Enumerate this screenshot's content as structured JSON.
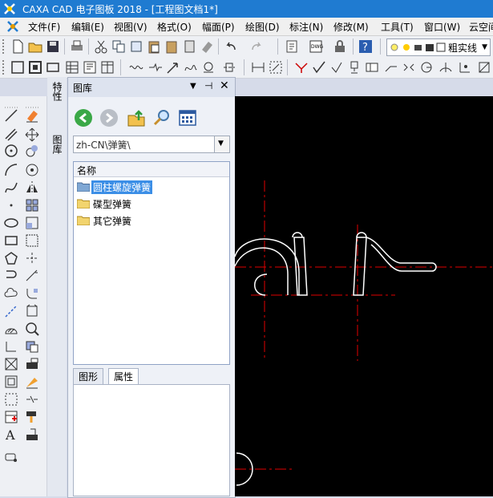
{
  "window": {
    "title": "CAXA CAD 电子图板 2018 - [工程图文档1*]"
  },
  "menu": {
    "items": [
      {
        "label": "文件(F)"
      },
      {
        "label": "编辑(E)"
      },
      {
        "label": "视图(V)"
      },
      {
        "label": "格式(O)"
      },
      {
        "label": "幅面(P)"
      },
      {
        "label": "绘图(D)"
      },
      {
        "label": "标注(N)"
      },
      {
        "label": "修改(M)"
      },
      {
        "label": "工具(T)"
      },
      {
        "label": "窗口(W)"
      },
      {
        "label": "云空间"
      }
    ]
  },
  "toolbar": {
    "line_style": "粗实线"
  },
  "side_tabs": {
    "properties": "特性",
    "library": "图库"
  },
  "library": {
    "title": "图库",
    "path": "zh-CN\\弹簧\\",
    "column_header": "名称",
    "items": [
      {
        "label": "圆柱螺旋弹簧",
        "selected": true
      },
      {
        "label": "碟型弹簧",
        "selected": false
      },
      {
        "label": "其它弹簧",
        "selected": false
      }
    ],
    "tabs": [
      {
        "label": "图形",
        "active": false
      },
      {
        "label": "属性",
        "active": true
      }
    ]
  },
  "colors": {
    "titlebar": "#1f7bd1",
    "canvas": "#000000",
    "centerline": "#e00000",
    "selection": "#3b8ee6"
  }
}
